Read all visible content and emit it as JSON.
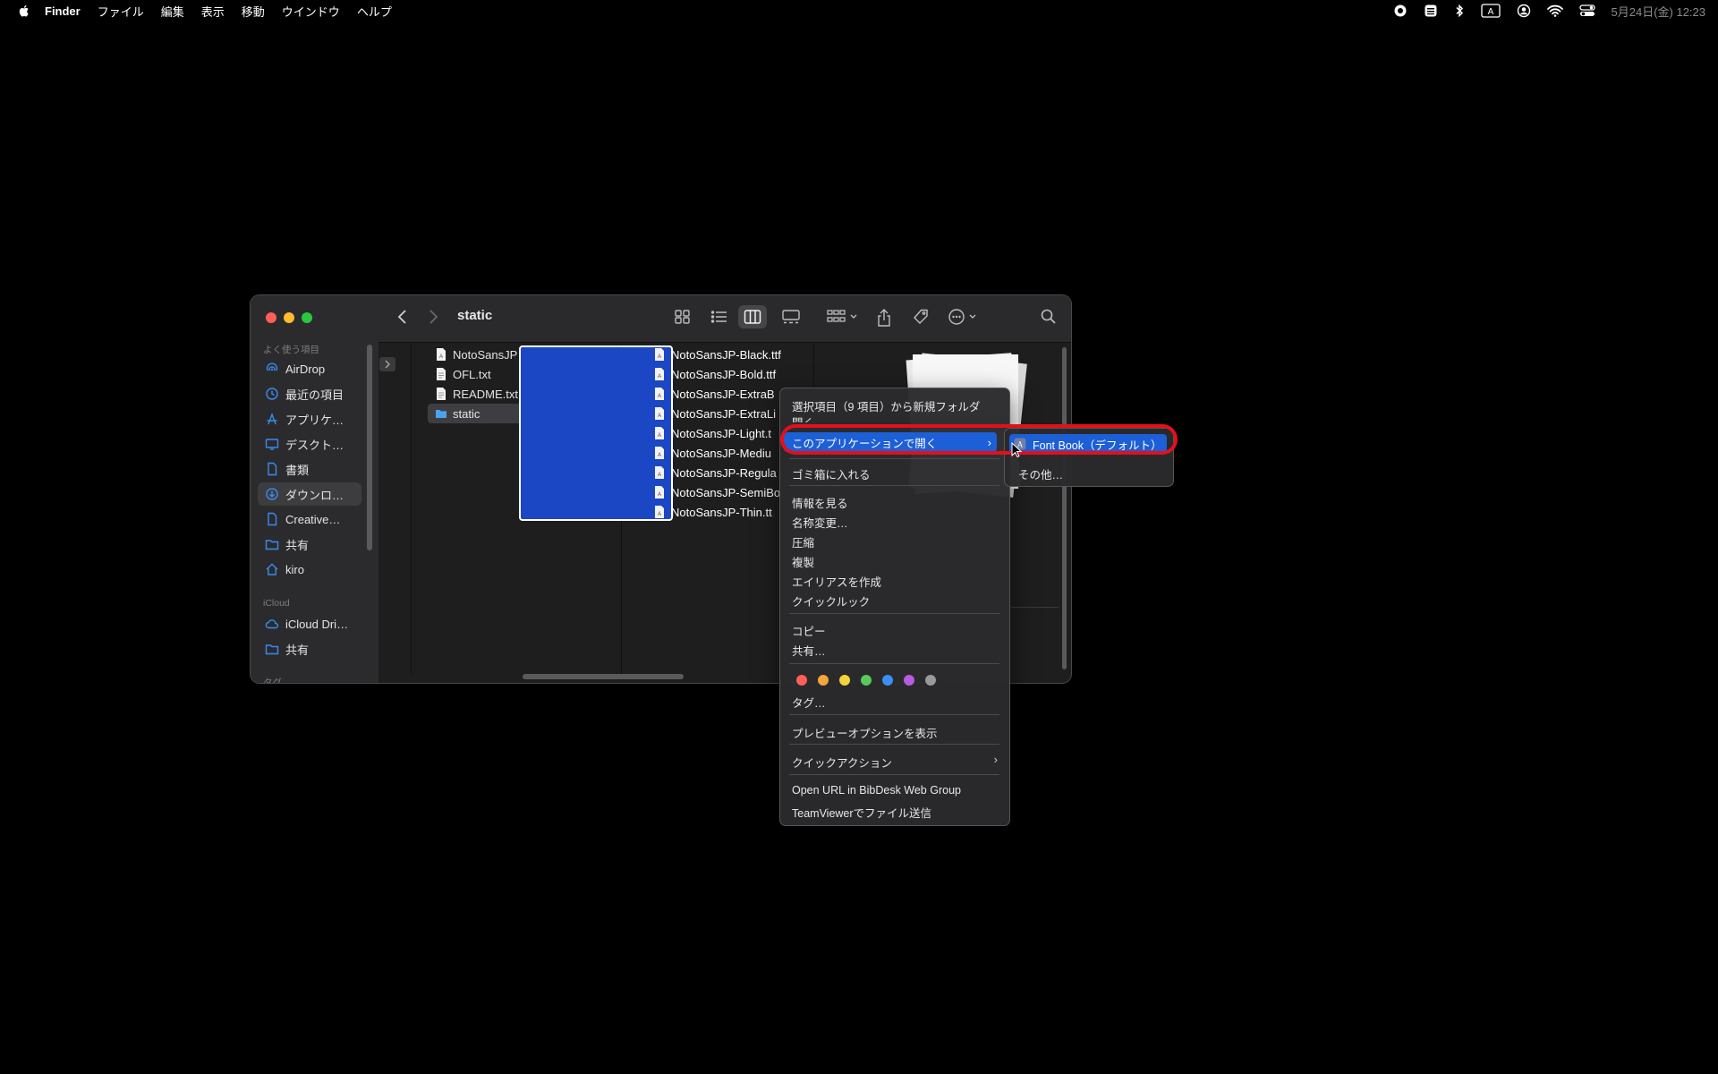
{
  "menubar": {
    "app": "Finder",
    "menus": [
      "ファイル",
      "編集",
      "表示",
      "移動",
      "ウインドウ",
      "ヘルプ"
    ],
    "clock": "5月24日(金)  12:23",
    "status_icons": [
      "record-icon",
      "keyboard-icon",
      "bluetooth-icon",
      "input-source-icon",
      "user-icon",
      "wifi-icon",
      "control-center-icon"
    ]
  },
  "window": {
    "title": "static"
  },
  "sidebar": {
    "favorites_label": "よく使う項目",
    "favorites": [
      "AirDrop",
      "最近の項目",
      "アプリケ…",
      "デスクト…",
      "書類",
      "ダウンロ…",
      "Creative…",
      "共有",
      "kiro"
    ],
    "icloud_label": "iCloud",
    "icloud": [
      "iCloud Dri…",
      "共有"
    ],
    "tags_label": "タグ"
  },
  "column1": {
    "files": [
      "NotoSansJP…Font_wght.ttf",
      "OFL.txt",
      "README.txt",
      "static"
    ]
  },
  "column2": {
    "files": [
      "NotoSansJP-Black.ttf",
      "NotoSansJP-Bold.ttf",
      "NotoSansJP-ExtraB",
      "NotoSansJP-ExtraLi",
      "NotoSansJP-Light.t",
      "NotoSansJP-Mediu",
      "NotoSansJP-Regula",
      "NotoSansJP-SemiBo",
      "NotoSansJP-Thin.tt"
    ]
  },
  "context_menu": {
    "new_folder": "選択項目（9 項目）から新規フォルダ",
    "open": "開く",
    "open_with": "このアプリケーションで開く",
    "trash": "ゴミ箱に入れる",
    "info": "情報を見る",
    "rename": "名称変更…",
    "compress": "圧縮",
    "duplicate": "複製",
    "alias": "エイリアスを作成",
    "quicklook": "クイックルック",
    "copy": "コピー",
    "share": "共有…",
    "tags": "タグ…",
    "preview_options": "プレビューオプションを表示",
    "quick_actions": "クイックアクション",
    "bibdesk": "Open URL in BibDesk Web Group",
    "teamviewer": "TeamViewerでファイル送信",
    "tag_colors": [
      "#ff5f57",
      "#f6a43b",
      "#f5d33b",
      "#5ac95a",
      "#3a8ef6",
      "#b65ce0",
      "#9a9a9a"
    ]
  },
  "submenu": {
    "default_app": "Font Book（デフォルト）",
    "other": "その他…"
  }
}
